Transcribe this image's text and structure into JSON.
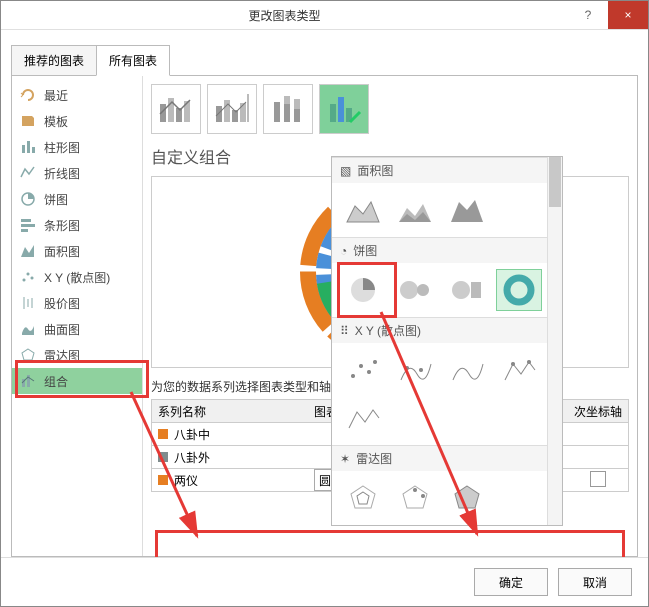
{
  "title": "更改图表类型",
  "titlebar": {
    "help": "?",
    "close": "×"
  },
  "tabs": {
    "recommended": "推荐的图表",
    "all": "所有图表"
  },
  "sidebar": [
    {
      "key": "recent",
      "label": "最近",
      "color": "#d4a360"
    },
    {
      "key": "templates",
      "label": "模板",
      "color": "#d4a360"
    },
    {
      "key": "column",
      "label": "柱形图",
      "color": "#8aa"
    },
    {
      "key": "line",
      "label": "折线图",
      "color": "#8aa"
    },
    {
      "key": "pie",
      "label": "饼图",
      "color": "#8aa"
    },
    {
      "key": "bar",
      "label": "条形图",
      "color": "#8aa"
    },
    {
      "key": "area",
      "label": "面积图",
      "color": "#8aa"
    },
    {
      "key": "xy",
      "label": "X Y (散点图)",
      "color": "#8aa"
    },
    {
      "key": "stock",
      "label": "股价图",
      "color": "#8aa"
    },
    {
      "key": "surface",
      "label": "曲面图",
      "color": "#8aa"
    },
    {
      "key": "radar",
      "label": "雷达图",
      "color": "#8aa"
    },
    {
      "key": "combo",
      "label": "组合",
      "color": "#8aa",
      "selected": true
    }
  ],
  "section_title": "自定义组合",
  "grid_label": "为您的数据系列选择图表类型和轴:",
  "series_header": {
    "name": "系列名称",
    "type": "图表类型",
    "axis": "次坐标轴"
  },
  "series": [
    {
      "name": "八卦中",
      "color": "#e67e22"
    },
    {
      "name": "八卦外",
      "color": "#7f8c8d"
    }
  ],
  "series_last": {
    "name": "两仪",
    "color": "#e67e22",
    "dropdown": "圆环图"
  },
  "picker": {
    "cat_area": "面积图",
    "cat_pie": "饼图",
    "cat_xy": "X Y (散点图)",
    "cat_radar": "雷达图"
  },
  "buttons": {
    "ok": "确定",
    "cancel": "取消"
  },
  "chart_data": {
    "type": "doughnut",
    "title": "",
    "series": [
      {
        "name": "两仪",
        "values": [
          50,
          50
        ]
      },
      {
        "name": "八卦中",
        "values": [
          12.5,
          12.5,
          12.5,
          12.5,
          12.5,
          12.5,
          12.5,
          12.5
        ]
      },
      {
        "name": "八卦外",
        "values": [
          12.5,
          12.5,
          12.5,
          12.5,
          12.5,
          12.5,
          12.5,
          12.5
        ]
      }
    ]
  }
}
